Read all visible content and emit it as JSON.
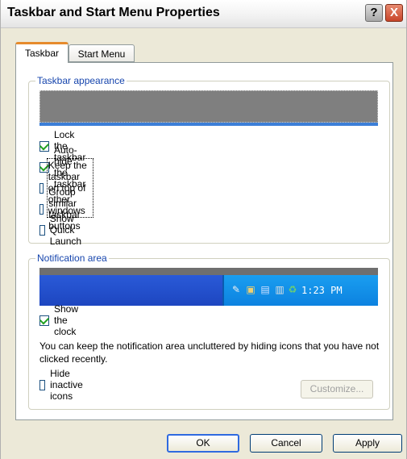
{
  "window": {
    "title": "Taskbar and Start Menu Properties",
    "help_label": "?",
    "close_label": "X"
  },
  "tabs": [
    {
      "label": "Taskbar"
    },
    {
      "label": "Start Menu"
    }
  ],
  "taskbar_appearance": {
    "legend": "Taskbar appearance",
    "options": [
      {
        "label": "Lock the taskbar",
        "checked": true
      },
      {
        "label": "Auto-hide the taskbar",
        "checked": true
      },
      {
        "label": "Keep the taskbar on top of other windows",
        "checked": false
      },
      {
        "label": "Group similar taskbar buttons",
        "checked": false
      },
      {
        "label": "Show Quick Launch",
        "checked": false
      }
    ]
  },
  "notification_area": {
    "legend": "Notification area",
    "clock_text": "1:23 PM",
    "tray_icons": [
      "tool-icon",
      "network-icon",
      "monitor-icon",
      "volume-icon",
      "sync-icon"
    ],
    "show_clock": {
      "label": "Show the clock",
      "checked": true
    },
    "note": "You can keep the notification area uncluttered by hiding icons that you have not clicked recently.",
    "hide_inactive": {
      "label": "Hide inactive icons",
      "checked": false
    },
    "customize_label": "Customize..."
  },
  "buttons": {
    "ok": "OK",
    "cancel": "Cancel",
    "apply": "Apply"
  },
  "colors": {
    "tab_accent": "#e68b2c",
    "legend_text": "#1645ad",
    "taskbar_blue": "#1d46c0",
    "tray_blue": "#0c82e0"
  }
}
